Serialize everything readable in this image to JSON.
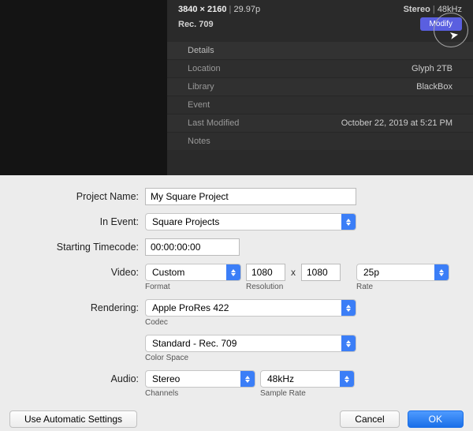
{
  "inspector": {
    "resolution": "3840 × 2160",
    "fps": "29.97p",
    "audio": "Stereo",
    "sample": "48kHz",
    "colorspace": "Rec. 709",
    "modify": "Modify",
    "details_header": "Details",
    "rows": {
      "location_label": "Location",
      "location_value": "Glyph 2TB",
      "library_label": "Library",
      "library_value": "BlackBox",
      "event_label": "Event",
      "event_value": "",
      "modified_label": "Last Modified",
      "modified_value": "October 22, 2019 at 5:21 PM",
      "notes_label": "Notes",
      "notes_value": ""
    }
  },
  "dialog": {
    "project_name_label": "Project Name:",
    "project_name": "My Square Project",
    "in_event_label": "In Event:",
    "in_event": "Square Projects",
    "timecode_label": "Starting Timecode:",
    "timecode": "00:00:00:00",
    "video_label": "Video:",
    "format": "Custom",
    "format_sub": "Format",
    "res_w": "1080",
    "res_h": "1080",
    "res_sub": "Resolution",
    "rate": "25p",
    "rate_sub": "Rate",
    "rendering_label": "Rendering:",
    "codec": "Apple ProRes 422",
    "codec_sub": "Codec",
    "colorspace": "Standard - Rec. 709",
    "colorspace_sub": "Color Space",
    "audio_label": "Audio:",
    "channels": "Stereo",
    "channels_sub": "Channels",
    "samplerate": "48kHz",
    "samplerate_sub": "Sample Rate",
    "auto": "Use Automatic Settings",
    "cancel": "Cancel",
    "ok": "OK"
  }
}
